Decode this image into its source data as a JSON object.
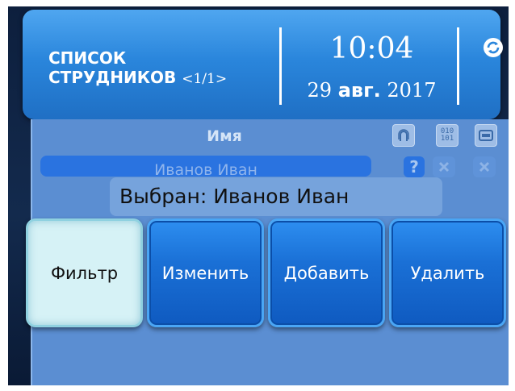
{
  "header": {
    "title_line1": "СПИСОК",
    "title_line2": "СТРУДНИКОВ",
    "page_indicator": "<1/1>",
    "time": "10:04",
    "date_day": "29",
    "date_month": "авг.",
    "date_year": "2017",
    "sync_icon": "sync-icon"
  },
  "table": {
    "column_name": "Имя",
    "column_icons": [
      "fingerprint-icon",
      "code-icon",
      "card-icon"
    ],
    "code_icon_text": "010\n101",
    "rows": [
      {
        "name": "Иванов Иван",
        "fingerprint": "?",
        "code": "none",
        "card": "none"
      }
    ]
  },
  "selection": {
    "text": "Выбран: Иванов Иван"
  },
  "buttons": {
    "filter": "Фильтр",
    "edit": "Изменить",
    "add": "Добавить",
    "delete": "Удалить"
  },
  "colors": {
    "header": "#2a86dc",
    "panel": "#5b8ed2",
    "button": "#1a70d6",
    "active_button": "#d6f2f6"
  }
}
